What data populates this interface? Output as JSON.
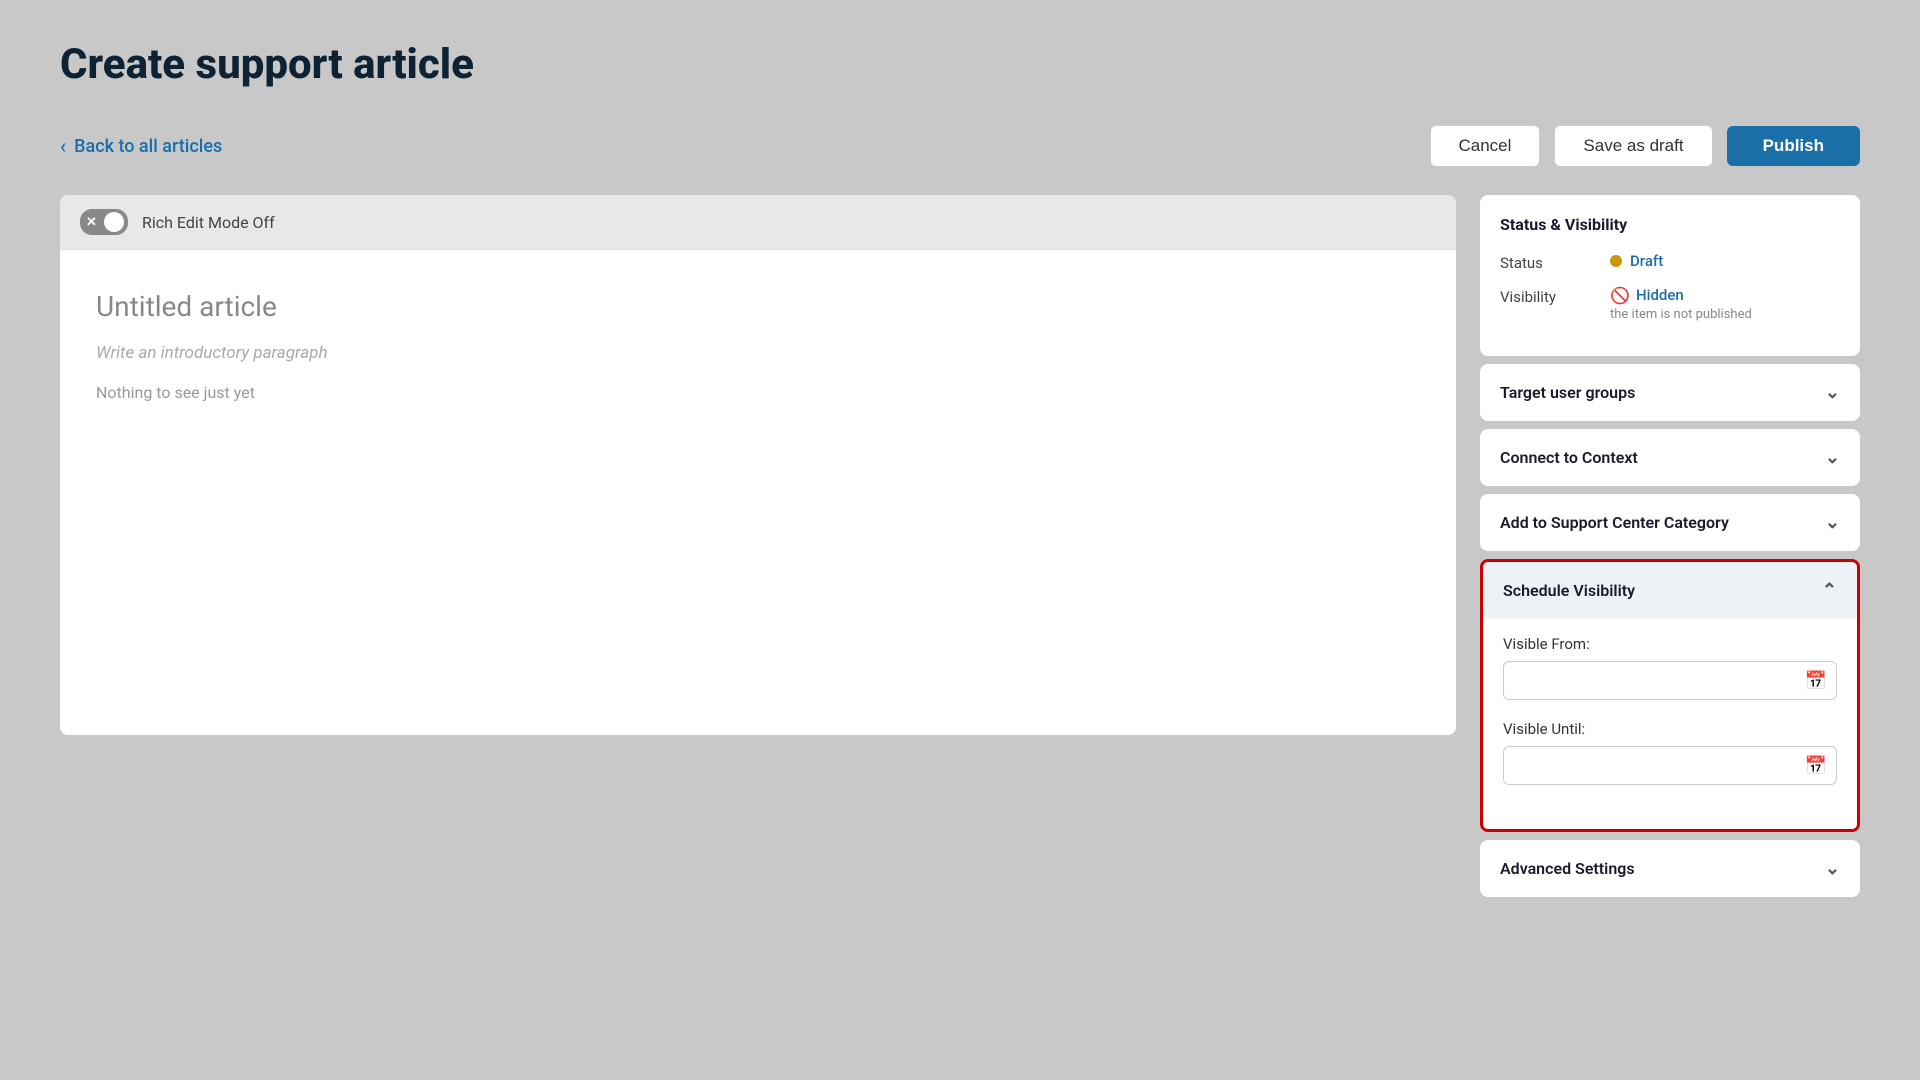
{
  "page": {
    "title": "Create support article"
  },
  "nav": {
    "back_label": "Back to all articles"
  },
  "toolbar": {
    "cancel_label": "Cancel",
    "save_draft_label": "Save as draft",
    "publish_label": "Publish"
  },
  "editor": {
    "mode_label": "Rich Edit Mode Off",
    "article_title_placeholder": "Untitled article",
    "intro_placeholder": "Write an introductory paragraph",
    "empty_text": "Nothing to see just yet"
  },
  "sidebar": {
    "status_visibility_title": "Status & Visibility",
    "status_label": "Status",
    "status_value": "Draft",
    "visibility_label": "Visibility",
    "visibility_value": "Hidden",
    "visibility_sub": "the item is not published",
    "target_users_label": "Target user groups",
    "connect_context_label": "Connect to Context",
    "add_support_label": "Add to Support Center Category",
    "schedule_label": "Schedule Visibility",
    "visible_from_label": "Visible From:",
    "visible_from_placeholder": "",
    "visible_until_label": "Visible Until:",
    "visible_until_placeholder": "",
    "advanced_label": "Advanced Settings"
  }
}
